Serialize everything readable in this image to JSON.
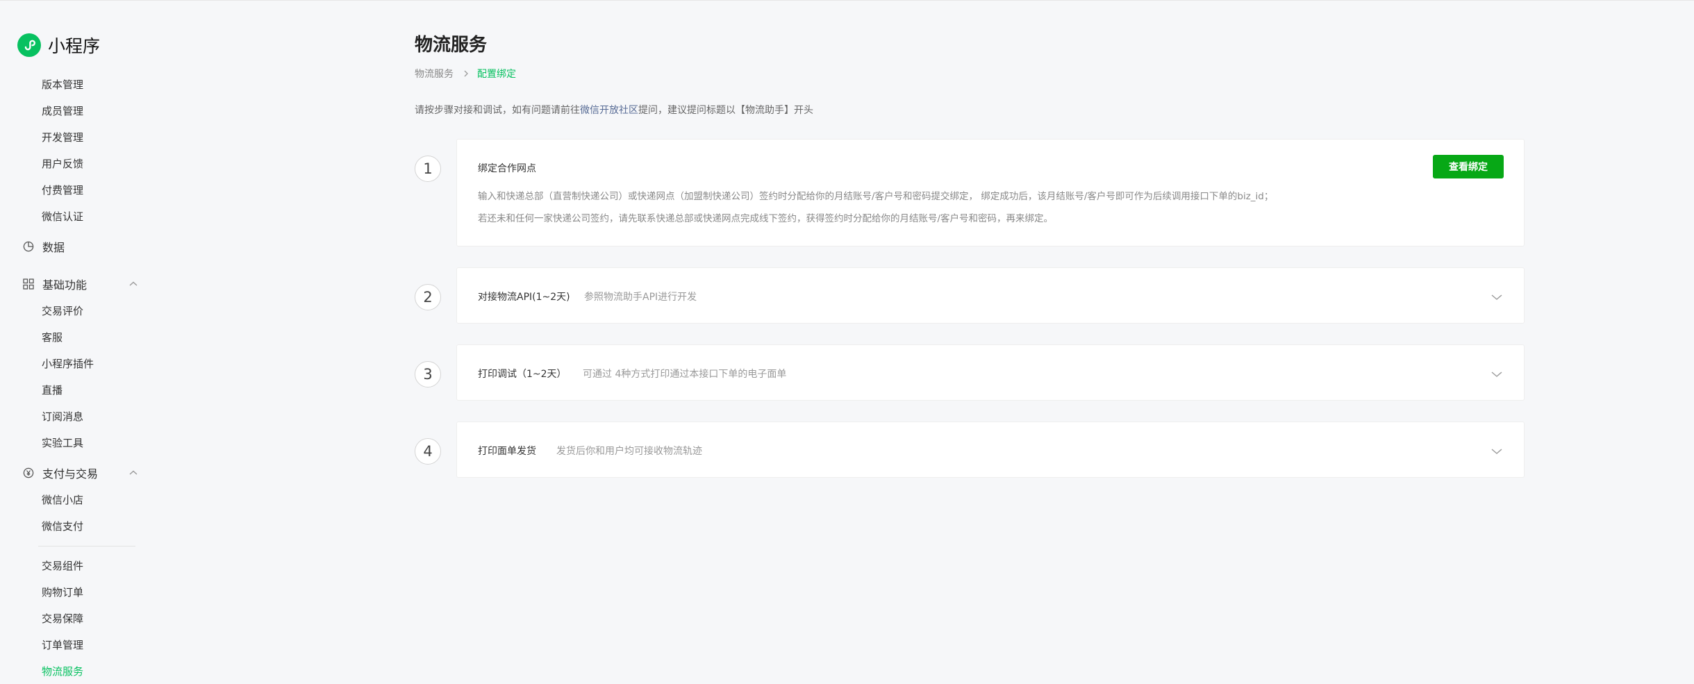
{
  "app": {
    "title": "小程序"
  },
  "sidebar": {
    "items_top": [
      {
        "label": "版本管理"
      },
      {
        "label": "成员管理"
      },
      {
        "label": "开发管理"
      },
      {
        "label": "用户反馈"
      },
      {
        "label": "付费管理"
      },
      {
        "label": "微信认证"
      }
    ],
    "data_group": {
      "label": "数据"
    },
    "basic_group": {
      "label": "基础功能",
      "items": [
        {
          "label": "交易评价"
        },
        {
          "label": "客服"
        },
        {
          "label": "小程序插件"
        },
        {
          "label": "直播"
        },
        {
          "label": "订阅消息"
        },
        {
          "label": "实验工具"
        }
      ]
    },
    "pay_group": {
      "label": "支付与交易",
      "items_a": [
        {
          "label": "微信小店"
        },
        {
          "label": "微信支付"
        }
      ],
      "items_b": [
        {
          "label": "交易组件"
        },
        {
          "label": "购物订单"
        },
        {
          "label": "交易保障"
        },
        {
          "label": "订单管理"
        },
        {
          "label": "物流服务",
          "active": true
        }
      ]
    }
  },
  "main": {
    "title": "物流服务",
    "breadcrumb": [
      "物流服务",
      "配置绑定"
    ],
    "notice": {
      "before": "请按步骤对接和调试，如有问题请前往",
      "link": "微信开放社区",
      "after": "提问，建议提问标题以【物流助手】开头"
    },
    "steps": [
      {
        "number": "1",
        "title": "绑定合作网点",
        "button": "查看绑定",
        "lines": [
          "输入和快递总部（直营制快递公司）或快递网点（加盟制快递公司）签约时分配给你的月结账号/客户号和密码提交绑定， 绑定成功后，该月结账号/客户号即可作为后续调用接口下单的biz_id；",
          "若还未和任何一家快递公司签约，请先联系快递总部或快递网点完成线下签约，获得签约时分配给你的月结账号/客户号和密码，再来绑定。"
        ]
      },
      {
        "number": "2",
        "title": "对接物流API(1~2天)",
        "desc": "参照物流助手API进行开发"
      },
      {
        "number": "3",
        "title": "打印调试（1~2天）",
        "desc": "可通过 4种方式打印通过本接口下单的电子面单"
      },
      {
        "number": "4",
        "title": "打印面单发货",
        "desc": "发货后你和用户均可接收物流轨迹"
      }
    ]
  }
}
